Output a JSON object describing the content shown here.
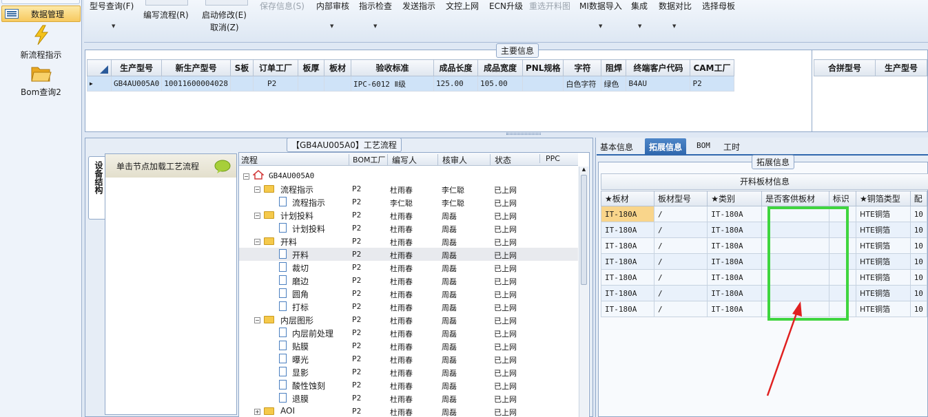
{
  "nav": {
    "active_label": "数据管理",
    "items": [
      {
        "label": "新流程指示",
        "icon": "lightning-icon"
      },
      {
        "label": "Bom查询2",
        "icon": "open-folder-icon"
      }
    ]
  },
  "toolbar": {
    "model_query": "型号查询(F)",
    "edit_flow": "编写流程(R)",
    "start_edit": "启动修改(E)",
    "cancel": "取消(Z)",
    "save_info": "保存信息(S)",
    "internal_review": "内部审核",
    "check_instruction": "指示检查",
    "send_instruction": "发送指示",
    "online": "文控上网",
    "ecn_upgrade": "ECN升级",
    "reselect": "重选开料图",
    "mi_import": "MI数据导入",
    "integration": "集成",
    "data_compare": "数据对比",
    "select_mother": "选择母板"
  },
  "main_info": {
    "title": "主要信息",
    "columns": [
      "生产型号",
      "新生产型号",
      "S板",
      "订单工厂",
      "板厚",
      "板材",
      "验收标准",
      "成品长度",
      "成品宽度",
      "PNL规格",
      "字符",
      "阻焊",
      "终端客户代码",
      "CAM工厂"
    ],
    "row": [
      "GB4AU005A0",
      "10011600004028",
      "",
      "P2",
      "",
      "",
      "IPC-6012 Ⅱ级",
      "125.00",
      "105.00",
      "",
      "白色字符",
      "绿色",
      "B4AU",
      "P2"
    ],
    "right_columns": [
      "合拼型号",
      "生产型号"
    ]
  },
  "flow": {
    "title": "【GB4AU005A0】工艺流程",
    "side_tab": "设备结构",
    "hint": "单击节点加载工艺流程",
    "columns": [
      "流程",
      "BOM工厂",
      "编写人",
      "核审人",
      "状态",
      "PPC"
    ],
    "root": "GB4AU005A0",
    "rows": [
      {
        "name": "流程指示",
        "level": 1,
        "type": "folder",
        "bom": "P2",
        "writer": "杜雨春",
        "reviewer": "李仁聪",
        "status": "已上网"
      },
      {
        "name": "流程指示",
        "level": 2,
        "type": "doc",
        "bom": "P2",
        "writer": "李仁聪",
        "reviewer": "李仁聪",
        "status": "已上网"
      },
      {
        "name": "计划投料",
        "level": 1,
        "type": "folder",
        "bom": "P2",
        "writer": "杜雨春",
        "reviewer": "周磊",
        "status": "已上网"
      },
      {
        "name": "计划投料",
        "level": 2,
        "type": "doc",
        "bom": "P2",
        "writer": "杜雨春",
        "reviewer": "周磊",
        "status": "已上网"
      },
      {
        "name": "开料",
        "level": 1,
        "type": "folder",
        "bom": "P2",
        "writer": "杜雨春",
        "reviewer": "周磊",
        "status": "已上网"
      },
      {
        "name": "开料",
        "level": 2,
        "type": "doc",
        "bom": "P2",
        "writer": "杜雨春",
        "reviewer": "周磊",
        "status": "已上网",
        "selected": true
      },
      {
        "name": "裁切",
        "level": 2,
        "type": "doc",
        "bom": "P2",
        "writer": "杜雨春",
        "reviewer": "周磊",
        "status": "已上网"
      },
      {
        "name": "磨边",
        "level": 2,
        "type": "doc",
        "bom": "P2",
        "writer": "杜雨春",
        "reviewer": "周磊",
        "status": "已上网"
      },
      {
        "name": "圆角",
        "level": 2,
        "type": "doc",
        "bom": "P2",
        "writer": "杜雨春",
        "reviewer": "周磊",
        "status": "已上网"
      },
      {
        "name": "打标",
        "level": 2,
        "type": "doc",
        "bom": "P2",
        "writer": "杜雨春",
        "reviewer": "周磊",
        "status": "已上网"
      },
      {
        "name": "内层图形",
        "level": 1,
        "type": "folder",
        "bom": "P2",
        "writer": "杜雨春",
        "reviewer": "周磊",
        "status": "已上网"
      },
      {
        "name": "内层前处理",
        "level": 2,
        "type": "doc",
        "bom": "P2",
        "writer": "杜雨春",
        "reviewer": "周磊",
        "status": "已上网"
      },
      {
        "name": "贴膜",
        "level": 2,
        "type": "doc",
        "bom": "P2",
        "writer": "杜雨春",
        "reviewer": "周磊",
        "status": "已上网"
      },
      {
        "name": "曝光",
        "level": 2,
        "type": "doc",
        "bom": "P2",
        "writer": "杜雨春",
        "reviewer": "周磊",
        "status": "已上网"
      },
      {
        "name": "显影",
        "level": 2,
        "type": "doc",
        "bom": "P2",
        "writer": "杜雨春",
        "reviewer": "周磊",
        "status": "已上网"
      },
      {
        "name": "酸性蚀刻",
        "level": 2,
        "type": "doc",
        "bom": "P2",
        "writer": "杜雨春",
        "reviewer": "周磊",
        "status": "已上网"
      },
      {
        "name": "退膜",
        "level": 2,
        "type": "doc",
        "bom": "P2",
        "writer": "杜雨春",
        "reviewer": "周磊",
        "status": "已上网"
      },
      {
        "name": "AOI",
        "level": 1,
        "type": "folder",
        "bom": "P2",
        "writer": "杜雨春",
        "reviewer": "周磊",
        "status": "已上网"
      }
    ]
  },
  "tabs": [
    "基本信息",
    "拓展信息",
    "BOM",
    "工时"
  ],
  "ext": {
    "title": "拓展信息",
    "table_title": "开料板材信息",
    "columns": [
      "★板材",
      "板材型号",
      "★类别",
      "是否客供板材",
      "标识",
      "★铜箔类型",
      "配"
    ],
    "rows": [
      [
        "IT-180A",
        "/",
        "IT-180A",
        "",
        "",
        "HTE铜箔",
        "10"
      ],
      [
        "IT-180A",
        "/",
        "IT-180A",
        "",
        "",
        "HTE铜箔",
        "10"
      ],
      [
        "IT-180A",
        "/",
        "IT-180A",
        "",
        "",
        "HTE铜箔",
        "10"
      ],
      [
        "IT-180A",
        "/",
        "IT-180A",
        "",
        "",
        "HTE铜箔",
        "10"
      ],
      [
        "IT-180A",
        "/",
        "IT-180A",
        "",
        "",
        "HTE铜箔",
        "10"
      ],
      [
        "IT-180A",
        "/",
        "IT-180A",
        "",
        "",
        "HTE铜箔",
        "10"
      ],
      [
        "IT-180A",
        "/",
        "IT-180A",
        "",
        "",
        "HTE铜箔",
        "10"
      ]
    ]
  },
  "colors": {
    "annotation_box": "#3fd53f",
    "annotation_arrow": "#e02020",
    "active_tab": "#2f67ad"
  }
}
